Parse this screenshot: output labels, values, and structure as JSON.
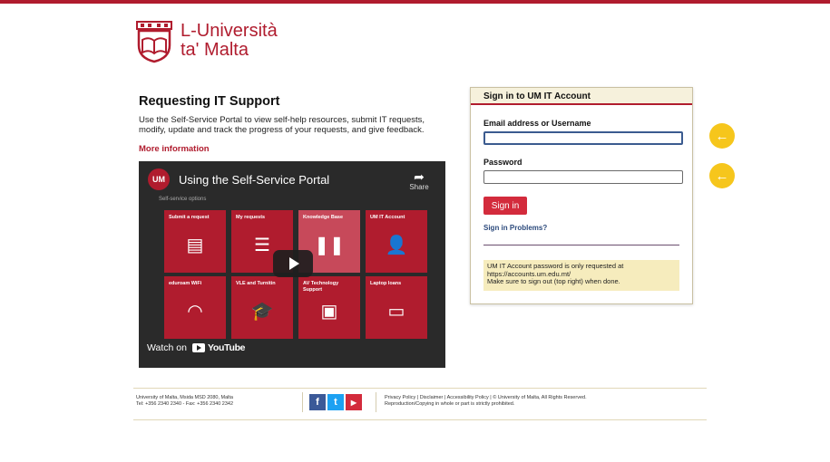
{
  "brand": {
    "name_line1": "L-Università",
    "name_line2": "ta' Malta",
    "accent_color": "#b01c2e"
  },
  "support": {
    "heading": "Requesting IT Support",
    "intro": "Use the Self-Service Portal to view self-help resources, submit IT requests, modify, update and track the progress of your requests, and give feedback.",
    "more_link": "More information"
  },
  "video": {
    "channel_badge": "UM",
    "title": "Using the Self-Service Portal",
    "share_label": "Share",
    "section_label": "Self-service options",
    "watch_on": "Watch on",
    "youtube_label": "YouTube",
    "tiles": [
      {
        "label": "Submit a request",
        "icon": "form-icon",
        "glyph": "▤"
      },
      {
        "label": "My requests",
        "icon": "checklist-icon",
        "glyph": "☰"
      },
      {
        "label": "Knowledge Base",
        "icon": "books-icon",
        "glyph": "❚❚"
      },
      {
        "label": "UM IT Account",
        "icon": "user-key-icon",
        "glyph": "👤"
      },
      {
        "label": "eduroam WiFi",
        "icon": "wifi-icon",
        "glyph": "◠"
      },
      {
        "label": "VLE and Turnitin",
        "icon": "graduation-cap-icon",
        "glyph": "🎓"
      },
      {
        "label": "AV Technology Support",
        "icon": "projector-icon",
        "glyph": "▣"
      },
      {
        "label": "Laptop loans",
        "icon": "laptop-icon",
        "glyph": "▭"
      }
    ]
  },
  "signin": {
    "title": "Sign in to UM IT Account",
    "username_label": "Email address or Username",
    "username_value": "",
    "password_label": "Password",
    "password_value": "",
    "button_label": "Sign in",
    "problems_link": "Sign in Problems?",
    "note_line1": "UM IT Account password is only requested at",
    "note_line2": "https://accounts.um.edu.mt/",
    "note_line3": "Make sure to sign out (top right) when done."
  },
  "arrows": {
    "glyph": "←",
    "color": "#f6c61c"
  },
  "footer": {
    "address_line1": "University of Malta, Msida MSD 2080, Malta",
    "address_line2": "Tel: +356 2340 2340 - Fax: +356 2340 2342",
    "social": [
      {
        "name": "facebook-icon",
        "glyph": "f",
        "color": "#3b5998"
      },
      {
        "name": "twitter-icon",
        "glyph": "t",
        "color": "#1da1f2"
      },
      {
        "name": "youtube-icon",
        "glyph": "▶",
        "color": "#d32b3c"
      }
    ],
    "legal_line1": "Privacy Policy | Disclaimer | Accessibility Policy | © University of Malta, All Rights Reserved.",
    "legal_line2": "Reproduction/Copying in whole or part is strictly prohibited."
  }
}
